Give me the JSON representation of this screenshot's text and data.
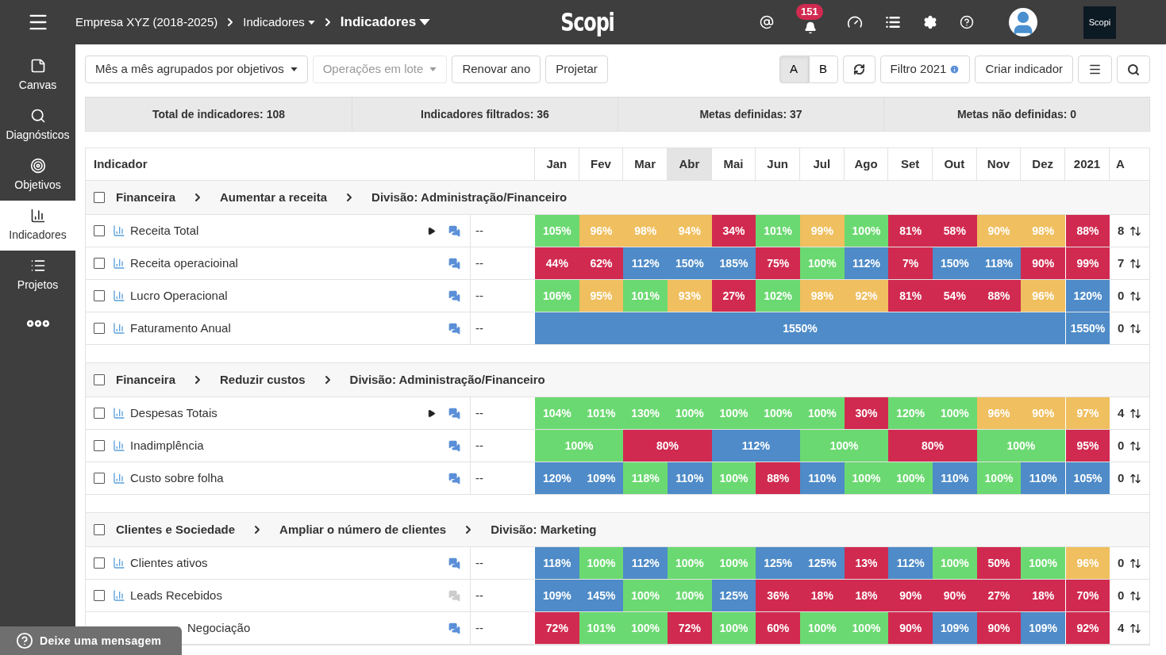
{
  "topbar": {
    "breadcrumb": [
      {
        "label": "Empresa XYZ (2018-2025)",
        "dropdown": false,
        "current": false
      },
      {
        "label": "Indicadores",
        "dropdown": true,
        "current": false
      },
      {
        "label": "Indicadores",
        "dropdown": true,
        "current": true
      }
    ],
    "logo": "Scopi",
    "notifications": "151",
    "brand": "Scopi"
  },
  "sidebar": [
    {
      "label": "Canvas",
      "selected": false
    },
    {
      "label": "Diagnósticos",
      "selected": false
    },
    {
      "label": "Objetivos",
      "selected": false
    },
    {
      "label": "Indicadores",
      "selected": true
    },
    {
      "label": "Projetos",
      "selected": false
    }
  ],
  "toolbar": {
    "view": "Mês a mês agrupados por objetivos",
    "batch": "Operações em lote",
    "batch_disabled": true,
    "renew": "Renovar ano",
    "project": "Projetar",
    "variants": [
      {
        "label": "A",
        "selected": true
      },
      {
        "label": "B",
        "selected": false
      }
    ],
    "filter": "Filtro 2021",
    "create": "Criar indicador"
  },
  "summary": [
    "Total de indicadores: 108",
    "Indicadores filtrados: 36",
    "Metas definidas: 37",
    "Metas não definidas: 0"
  ],
  "table": {
    "columns": {
      "name": "Indicador",
      "months": [
        {
          "label": "Jan",
          "selected": false
        },
        {
          "label": "Fev",
          "selected": false
        },
        {
          "label": "Mar",
          "selected": false
        },
        {
          "label": "Abr",
          "selected": true
        },
        {
          "label": "Mai",
          "selected": false
        },
        {
          "label": "Jun",
          "selected": false
        },
        {
          "label": "Jul",
          "selected": false
        },
        {
          "label": "Ago",
          "selected": false
        },
        {
          "label": "Set",
          "selected": false
        },
        {
          "label": "Out",
          "selected": false
        },
        {
          "label": "Nov",
          "selected": false
        },
        {
          "label": "Dez",
          "selected": false
        }
      ],
      "year": "2021",
      "column_16": "A"
    },
    "groups": [
      {
        "checked": false,
        "path": [
          "Financeira",
          "Aumentar a receita",
          "Divisão: Administração/Financeiro"
        ],
        "rows": [
          {
            "kind": "monthly",
            "obscured": false,
            "checked": false,
            "name": "Receita Total",
            "expandable": true,
            "has_comments": true,
            "target": "--",
            "cells": [
              {
                "value": "105%",
                "color": "#6bd971"
              },
              {
                "value": "96%",
                "color": "#f0bf5f"
              },
              {
                "value": "98%",
                "color": "#f0bf5f"
              },
              {
                "value": "94%",
                "color": "#f0bf5f"
              },
              {
                "value": "34%",
                "color": "#d12a50"
              },
              {
                "value": "101%",
                "color": "#6bd971"
              },
              {
                "value": "99%",
                "color": "#f0bf5f"
              },
              {
                "value": "100%",
                "color": "#6bd971"
              },
              {
                "value": "81%",
                "color": "#d12a50"
              },
              {
                "value": "58%",
                "color": "#d12a50"
              },
              {
                "value": "90%",
                "color": "#f0bf5f"
              },
              {
                "value": "98%",
                "color": "#f0bf5f"
              }
            ],
            "total": {
              "value": "88%",
              "color": "#d12a50"
            },
            "count": "8"
          },
          {
            "kind": "monthly",
            "obscured": false,
            "checked": false,
            "name": "Receita operacioinal",
            "expandable": false,
            "has_comments": true,
            "target": "--",
            "cells": [
              {
                "value": "44%",
                "color": "#d12a50"
              },
              {
                "value": "62%",
                "color": "#d12a50"
              },
              {
                "value": "112%",
                "color": "#4e8bc8"
              },
              {
                "value": "150%",
                "color": "#4e8bc8"
              },
              {
                "value": "185%",
                "color": "#4e8bc8"
              },
              {
                "value": "75%",
                "color": "#d12a50"
              },
              {
                "value": "100%",
                "color": "#6bd971"
              },
              {
                "value": "112%",
                "color": "#4e8bc8"
              },
              {
                "value": "7%",
                "color": "#d12a50"
              },
              {
                "value": "150%",
                "color": "#4e8bc8"
              },
              {
                "value": "118%",
                "color": "#4e8bc8"
              },
              {
                "value": "90%",
                "color": "#d12a50"
              }
            ],
            "total": {
              "value": "99%",
              "color": "#d12a50"
            },
            "count": "7"
          },
          {
            "kind": "monthly",
            "obscured": false,
            "checked": false,
            "name": "Lucro Operacional",
            "expandable": false,
            "has_comments": true,
            "target": "--",
            "cells": [
              {
                "value": "106%",
                "color": "#6bd971"
              },
              {
                "value": "95%",
                "color": "#f0bf5f"
              },
              {
                "value": "101%",
                "color": "#6bd971"
              },
              {
                "value": "93%",
                "color": "#f0bf5f"
              },
              {
                "value": "27%",
                "color": "#d12a50"
              },
              {
                "value": "102%",
                "color": "#6bd971"
              },
              {
                "value": "98%",
                "color": "#f0bf5f"
              },
              {
                "value": "92%",
                "color": "#f0bf5f"
              },
              {
                "value": "81%",
                "color": "#d12a50"
              },
              {
                "value": "54%",
                "color": "#d12a50"
              },
              {
                "value": "88%",
                "color": "#d12a50"
              },
              {
                "value": "96%",
                "color": "#f0bf5f"
              }
            ],
            "total": {
              "value": "120%",
              "color": "#4e8bc8"
            },
            "count": "0"
          },
          {
            "kind": "annual",
            "obscured": false,
            "checked": false,
            "name": "Faturamento Anual",
            "expandable": false,
            "has_comments": true,
            "target": "--",
            "cells": [
              {
                "value": "1550%",
                "color": "#4e8bc8"
              }
            ],
            "total": {
              "value": "1550%",
              "color": "#4e8bc8"
            },
            "count": "0"
          }
        ]
      },
      {
        "checked": false,
        "path": [
          "Financeira",
          "Reduzir custos",
          "Divisão: Administração/Financeiro"
        ],
        "rows": [
          {
            "kind": "monthly",
            "obscured": false,
            "checked": false,
            "name": "Despesas Totais",
            "expandable": true,
            "has_comments": true,
            "target": "--",
            "cells": [
              {
                "value": "104%",
                "color": "#6bd971"
              },
              {
                "value": "101%",
                "color": "#6bd971"
              },
              {
                "value": "130%",
                "color": "#6bd971"
              },
              {
                "value": "100%",
                "color": "#6bd971"
              },
              {
                "value": "100%",
                "color": "#6bd971"
              },
              {
                "value": "100%",
                "color": "#6bd971"
              },
              {
                "value": "100%",
                "color": "#6bd971"
              },
              {
                "value": "30%",
                "color": "#d12a50"
              },
              {
                "value": "120%",
                "color": "#6bd971"
              },
              {
                "value": "100%",
                "color": "#6bd971"
              },
              {
                "value": "96%",
                "color": "#f0bf5f"
              },
              {
                "value": "90%",
                "color": "#f0bf5f"
              }
            ],
            "total": {
              "value": "97%",
              "color": "#f0bf5f"
            },
            "count": "4"
          },
          {
            "kind": "bimonthly",
            "obscured": false,
            "checked": false,
            "name": "Inadimplência",
            "expandable": false,
            "has_comments": true,
            "target": "--",
            "cells": [
              {
                "value": "100%",
                "color": "#6bd971"
              },
              {
                "value": "80%",
                "color": "#d12a50"
              },
              {
                "value": "112%",
                "color": "#4e8bc8"
              },
              {
                "value": "100%",
                "color": "#6bd971"
              },
              {
                "value": "80%",
                "color": "#d12a50"
              },
              {
                "value": "100%",
                "color": "#6bd971"
              }
            ],
            "total": {
              "value": "95%",
              "color": "#d12a50"
            },
            "count": "0"
          },
          {
            "kind": "monthly",
            "obscured": false,
            "checked": false,
            "name": "Custo sobre folha",
            "expandable": false,
            "has_comments": true,
            "target": "--",
            "cells": [
              {
                "value": "120%",
                "color": "#4e8bc8"
              },
              {
                "value": "109%",
                "color": "#4e8bc8"
              },
              {
                "value": "118%",
                "color": "#6bd971"
              },
              {
                "value": "110%",
                "color": "#4e8bc8"
              },
              {
                "value": "100%",
                "color": "#6bd971"
              },
              {
                "value": "88%",
                "color": "#d12a50"
              },
              {
                "value": "110%",
                "color": "#4e8bc8"
              },
              {
                "value": "100%",
                "color": "#6bd971"
              },
              {
                "value": "100%",
                "color": "#6bd971"
              },
              {
                "value": "110%",
                "color": "#4e8bc8"
              },
              {
                "value": "100%",
                "color": "#6bd971"
              },
              {
                "value": "110%",
                "color": "#4e8bc8"
              }
            ],
            "total": {
              "value": "105%",
              "color": "#4e8bc8"
            },
            "count": "0"
          }
        ]
      },
      {
        "checked": false,
        "path": [
          "Clientes e Sociedade",
          "Ampliar o número de clientes",
          "Divisão: Marketing"
        ],
        "rows": [
          {
            "kind": "monthly",
            "obscured": false,
            "checked": false,
            "name": "Clientes ativos",
            "expandable": false,
            "has_comments": true,
            "target": "--",
            "cells": [
              {
                "value": "118%",
                "color": "#4e8bc8"
              },
              {
                "value": "100%",
                "color": "#6bd971"
              },
              {
                "value": "112%",
                "color": "#4e8bc8"
              },
              {
                "value": "100%",
                "color": "#6bd971"
              },
              {
                "value": "100%",
                "color": "#6bd971"
              },
              {
                "value": "125%",
                "color": "#4e8bc8"
              },
              {
                "value": "125%",
                "color": "#4e8bc8"
              },
              {
                "value": "13%",
                "color": "#d12a50"
              },
              {
                "value": "112%",
                "color": "#4e8bc8"
              },
              {
                "value": "100%",
                "color": "#6bd971"
              },
              {
                "value": "50%",
                "color": "#d12a50"
              },
              {
                "value": "100%",
                "color": "#6bd971"
              }
            ],
            "total": {
              "value": "96%",
              "color": "#f0bf5f"
            },
            "count": "0"
          },
          {
            "kind": "monthly",
            "obscured": false,
            "checked": false,
            "name": "Leads Recebidos",
            "expandable": false,
            "has_comments": false,
            "target": "--",
            "cells": [
              {
                "value": "109%",
                "color": "#4e8bc8"
              },
              {
                "value": "145%",
                "color": "#4e8bc8"
              },
              {
                "value": "100%",
                "color": "#6bd971"
              },
              {
                "value": "100%",
                "color": "#6bd971"
              },
              {
                "value": "125%",
                "color": "#4e8bc8"
              },
              {
                "value": "36%",
                "color": "#d12a50"
              },
              {
                "value": "18%",
                "color": "#d12a50"
              },
              {
                "value": "18%",
                "color": "#d12a50"
              },
              {
                "value": "90%",
                "color": "#d12a50"
              },
              {
                "value": "90%",
                "color": "#d12a50"
              },
              {
                "value": "27%",
                "color": "#d12a50"
              },
              {
                "value": "18%",
                "color": "#d12a50"
              }
            ],
            "total": {
              "value": "70%",
              "color": "#d12a50"
            },
            "count": "0"
          },
          {
            "kind": "monthly",
            "obscured": true,
            "name": "Negociação",
            "expandable": false,
            "has_comments": true,
            "target": "--",
            "cells": [
              {
                "value": "72%",
                "color": "#d12a50"
              },
              {
                "value": "101%",
                "color": "#6bd971"
              },
              {
                "value": "100%",
                "color": "#6bd971"
              },
              {
                "value": "72%",
                "color": "#d12a50"
              },
              {
                "value": "100%",
                "color": "#6bd971"
              },
              {
                "value": "60%",
                "color": "#d12a50"
              },
              {
                "value": "100%",
                "color": "#6bd971"
              },
              {
                "value": "100%",
                "color": "#6bd971"
              },
              {
                "value": "90%",
                "color": "#d12a50"
              },
              {
                "value": "109%",
                "color": "#4e8bc8"
              },
              {
                "value": "90%",
                "color": "#d12a50"
              },
              {
                "value": "109%",
                "color": "#4e8bc8"
              }
            ],
            "total": {
              "value": "92%",
              "color": "#d12a50"
            },
            "count": "4"
          }
        ]
      }
    ]
  },
  "feedback": "Deixe uma mensagem"
}
